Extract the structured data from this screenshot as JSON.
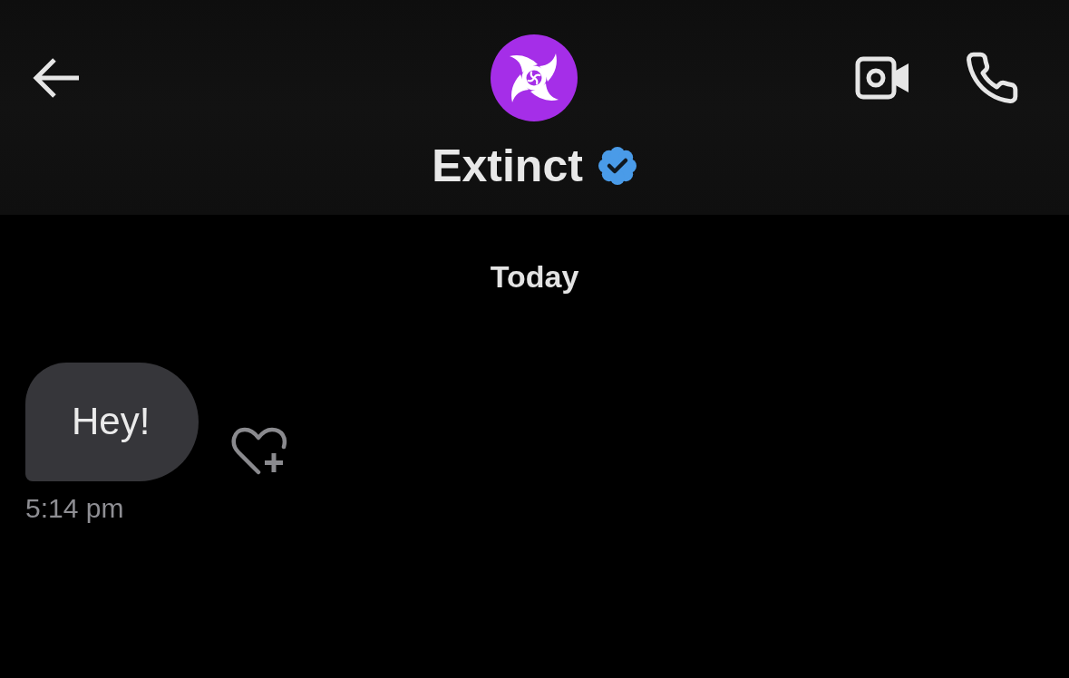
{
  "header": {
    "contact": {
      "name": "Extinct",
      "verified": true
    }
  },
  "date_separator": "Today",
  "messages": [
    {
      "kind": "incoming",
      "text": "Hey!",
      "time": "5:14 pm"
    }
  ]
}
